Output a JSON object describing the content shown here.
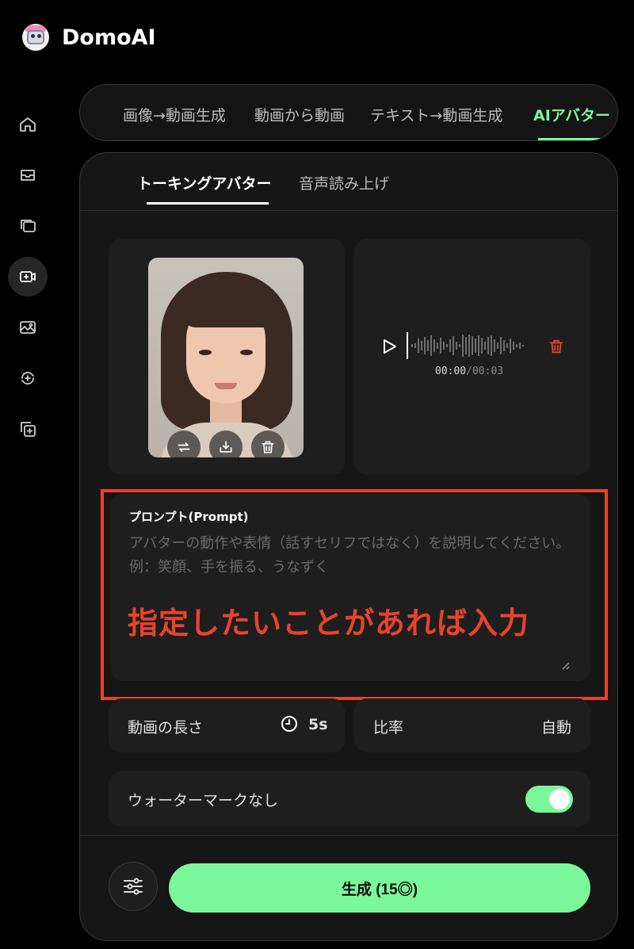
{
  "app": {
    "name": "DomoAI",
    "logo_icon": "robot-avatar-icon"
  },
  "sidebar": {
    "items": [
      {
        "icon": "home-icon",
        "active": false
      },
      {
        "icon": "inbox-icon",
        "active": false
      },
      {
        "icon": "gallery-icon",
        "active": false
      },
      {
        "icon": "video-avatar-icon",
        "active": true
      },
      {
        "icon": "image-icon",
        "active": false
      },
      {
        "icon": "refresh-sparkle-icon",
        "active": false
      },
      {
        "icon": "layers-plus-icon",
        "active": false
      }
    ]
  },
  "top_tabs": [
    {
      "label": "画像→動画生成",
      "active": false
    },
    {
      "label": "動画から動画",
      "active": false
    },
    {
      "label": "テキスト→動画生成",
      "active": false
    },
    {
      "label": "AIアバター",
      "active": true
    }
  ],
  "sub_tabs": [
    {
      "label": "トーキングアバター",
      "active": true
    },
    {
      "label": "音声読み上げ",
      "active": false
    }
  ],
  "image_card": {
    "actions": [
      "swap-icon",
      "save-icon",
      "trash-icon"
    ]
  },
  "audio_card": {
    "time_current": "00:00",
    "time_separator": "/",
    "time_total": "00:03"
  },
  "prompt": {
    "label": "プロンプト(Prompt)",
    "placeholder": "アバターの動作や表情（話すセリフではなく）を説明してください。例：笑顔、手を振る、うなずく",
    "value": ""
  },
  "annotation": {
    "text": "指定したいことがあれば入力",
    "color": "#e8432c"
  },
  "settings": {
    "duration_label": "動画の長さ",
    "duration_value": "5s",
    "ratio_label": "比率",
    "ratio_value": "自動",
    "watermark_label": "ウォーターマークなし",
    "watermark_enabled": true
  },
  "generate": {
    "label": "生成 (15◎)"
  },
  "colors": {
    "accent": "#7af79a",
    "background": "#000000",
    "panel": "#161616",
    "card": "#1e1e1e",
    "annotation": "#e8432c"
  }
}
